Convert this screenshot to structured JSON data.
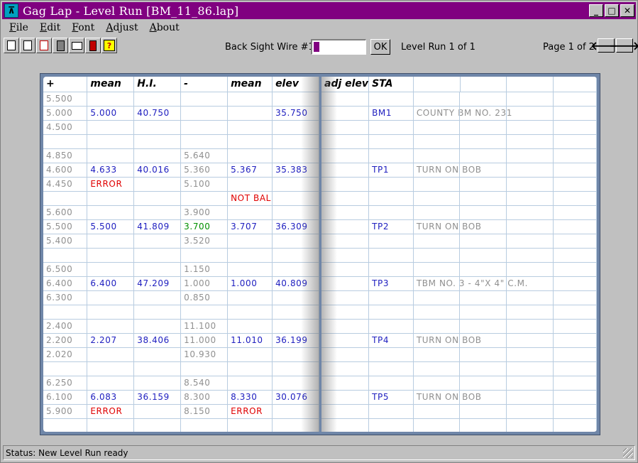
{
  "window": {
    "title": "Gag Lap - Level Run [BM_11_86.lap]",
    "accent": "#800080"
  },
  "menu": [
    {
      "label": "File",
      "ul": "F",
      "rest": "ile"
    },
    {
      "label": "Edit",
      "ul": "E",
      "rest": "dit"
    },
    {
      "label": "Font",
      "ul": "F",
      "rest": "ont"
    },
    {
      "label": "Adjust",
      "ul": "A",
      "rest": "djust"
    },
    {
      "label": "About",
      "ul": "A",
      "rest": "bout"
    }
  ],
  "toolbar": {
    "icons": [
      "new-file-icon",
      "open-file-icon",
      "save-file-icon",
      "calculator-icon",
      "print-icon",
      "device-icon",
      "help-icon"
    ],
    "backsight_label": "Back Sight Wire #1",
    "backsight_value": "",
    "ok_label": "OK",
    "run_label": "Level Run 1 of 1",
    "page_label": "Page 1 of 2"
  },
  "left_page": {
    "headers": [
      "+",
      "mean",
      "H.I.",
      "-",
      "mean",
      "elev"
    ],
    "rows": [
      [
        [
          "5.500",
          "gray"
        ],
        [
          "",
          ""
        ],
        [
          "",
          ""
        ],
        [
          "",
          ""
        ],
        [
          "",
          ""
        ],
        [
          "",
          ""
        ]
      ],
      [
        [
          "5.000",
          "gray"
        ],
        [
          "5.000",
          "blue"
        ],
        [
          "40.750",
          "blue"
        ],
        [
          "",
          ""
        ],
        [
          "",
          ""
        ],
        [
          "35.750",
          "blue"
        ]
      ],
      [
        [
          "4.500",
          "gray"
        ],
        [
          "",
          ""
        ],
        [
          "",
          ""
        ],
        [
          "",
          ""
        ],
        [
          "",
          ""
        ],
        [
          "",
          ""
        ]
      ],
      [
        [
          "",
          ""
        ],
        [
          "",
          ""
        ],
        [
          "",
          ""
        ],
        [
          "",
          ""
        ],
        [
          "",
          ""
        ],
        [
          "",
          ""
        ]
      ],
      [
        [
          "4.850",
          "gray"
        ],
        [
          "",
          ""
        ],
        [
          "",
          ""
        ],
        [
          "5.640",
          "gray"
        ],
        [
          "",
          ""
        ],
        [
          "",
          ""
        ]
      ],
      [
        [
          "4.600",
          "gray"
        ],
        [
          "4.633",
          "blue"
        ],
        [
          "40.016",
          "blue"
        ],
        [
          "5.360",
          "gray"
        ],
        [
          "5.367",
          "blue"
        ],
        [
          "35.383",
          "blue"
        ]
      ],
      [
        [
          "4.450",
          "gray"
        ],
        [
          "ERROR",
          "red"
        ],
        [
          "",
          ""
        ],
        [
          "5.100",
          "gray"
        ],
        [
          "",
          ""
        ],
        [
          "",
          ""
        ]
      ],
      [
        [
          "",
          ""
        ],
        [
          "",
          ""
        ],
        [
          "",
          ""
        ],
        [
          "",
          ""
        ],
        [
          "NOT BAL",
          "red"
        ],
        [
          "",
          ""
        ]
      ],
      [
        [
          "5.600",
          "gray"
        ],
        [
          "",
          ""
        ],
        [
          "",
          ""
        ],
        [
          "3.900",
          "gray"
        ],
        [
          "",
          ""
        ],
        [
          "",
          ""
        ]
      ],
      [
        [
          "5.500",
          "gray"
        ],
        [
          "5.500",
          "blue"
        ],
        [
          "41.809",
          "blue"
        ],
        [
          "3.700",
          "green"
        ],
        [
          "3.707",
          "blue"
        ],
        [
          "36.309",
          "blue"
        ]
      ],
      [
        [
          "5.400",
          "gray"
        ],
        [
          "",
          ""
        ],
        [
          "",
          ""
        ],
        [
          "3.520",
          "gray"
        ],
        [
          "",
          ""
        ],
        [
          "",
          ""
        ]
      ],
      [
        [
          "",
          ""
        ],
        [
          "",
          ""
        ],
        [
          "",
          ""
        ],
        [
          "",
          ""
        ],
        [
          "",
          ""
        ],
        [
          "",
          ""
        ]
      ],
      [
        [
          "6.500",
          "gray"
        ],
        [
          "",
          ""
        ],
        [
          "",
          ""
        ],
        [
          "1.150",
          "gray"
        ],
        [
          "",
          ""
        ],
        [
          "",
          ""
        ]
      ],
      [
        [
          "6.400",
          "gray"
        ],
        [
          "6.400",
          "blue"
        ],
        [
          "47.209",
          "blue"
        ],
        [
          "1.000",
          "gray"
        ],
        [
          "1.000",
          "blue"
        ],
        [
          "40.809",
          "blue"
        ]
      ],
      [
        [
          "6.300",
          "gray"
        ],
        [
          "",
          ""
        ],
        [
          "",
          ""
        ],
        [
          "0.850",
          "gray"
        ],
        [
          "",
          ""
        ],
        [
          "",
          ""
        ]
      ],
      [
        [
          "",
          ""
        ],
        [
          "",
          ""
        ],
        [
          "",
          ""
        ],
        [
          "",
          ""
        ],
        [
          "",
          ""
        ],
        [
          "",
          ""
        ]
      ],
      [
        [
          "2.400",
          "gray"
        ],
        [
          "",
          ""
        ],
        [
          "",
          ""
        ],
        [
          "11.100",
          "gray"
        ],
        [
          "",
          ""
        ],
        [
          "",
          ""
        ]
      ],
      [
        [
          "2.200",
          "gray"
        ],
        [
          "2.207",
          "blue"
        ],
        [
          "38.406",
          "blue"
        ],
        [
          "11.000",
          "gray"
        ],
        [
          "11.010",
          "blue"
        ],
        [
          "36.199",
          "blue"
        ]
      ],
      [
        [
          "2.020",
          "gray"
        ],
        [
          "",
          ""
        ],
        [
          "",
          ""
        ],
        [
          "10.930",
          "gray"
        ],
        [
          "",
          ""
        ],
        [
          "",
          ""
        ]
      ],
      [
        [
          "",
          ""
        ],
        [
          "",
          ""
        ],
        [
          "",
          ""
        ],
        [
          "",
          ""
        ],
        [
          "",
          ""
        ],
        [
          "",
          ""
        ]
      ],
      [
        [
          "6.250",
          "gray"
        ],
        [
          "",
          ""
        ],
        [
          "",
          ""
        ],
        [
          "8.540",
          "gray"
        ],
        [
          "",
          ""
        ],
        [
          "",
          ""
        ]
      ],
      [
        [
          "6.100",
          "gray"
        ],
        [
          "6.083",
          "blue"
        ],
        [
          "36.159",
          "blue"
        ],
        [
          "8.300",
          "gray"
        ],
        [
          "8.330",
          "blue"
        ],
        [
          "30.076",
          "blue"
        ]
      ],
      [
        [
          "5.900",
          "gray"
        ],
        [
          "ERROR",
          "red"
        ],
        [
          "",
          ""
        ],
        [
          "8.150",
          "gray"
        ],
        [
          "ERROR",
          "red"
        ],
        [
          "",
          ""
        ]
      ],
      [
        [
          "",
          ""
        ],
        [
          "",
          ""
        ],
        [
          "",
          ""
        ],
        [
          "",
          ""
        ],
        [
          "",
          ""
        ],
        [
          "",
          ""
        ]
      ]
    ]
  },
  "right_page": {
    "headers": [
      "adj elev",
      "STA",
      "",
      "",
      "",
      ""
    ],
    "rows": [
      [
        "",
        "",
        ""
      ],
      [
        "",
        "BM1",
        "COUNTY BM NO. 231"
      ],
      [
        "",
        "",
        ""
      ],
      [
        "",
        "",
        ""
      ],
      [
        "",
        "",
        ""
      ],
      [
        "",
        "TP1",
        "TURN ON BOB"
      ],
      [
        "",
        "",
        ""
      ],
      [
        "",
        "",
        ""
      ],
      [
        "",
        "",
        ""
      ],
      [
        "",
        "TP2",
        "TURN ON BOB"
      ],
      [
        "",
        "",
        ""
      ],
      [
        "",
        "",
        ""
      ],
      [
        "",
        "",
        ""
      ],
      [
        "",
        "TP3",
        "TBM NO. 3 - 4\"X 4\" C.M."
      ],
      [
        "",
        "",
        ""
      ],
      [
        "",
        "",
        ""
      ],
      [
        "",
        "",
        ""
      ],
      [
        "",
        "TP4",
        "TURN ON BOB"
      ],
      [
        "",
        "",
        ""
      ],
      [
        "",
        "",
        ""
      ],
      [
        "",
        "",
        ""
      ],
      [
        "",
        "TP5",
        "TURN ON BOB"
      ],
      [
        "",
        "",
        ""
      ],
      [
        "",
        "",
        ""
      ]
    ]
  },
  "status": {
    "text": "Status: New Level Run ready"
  }
}
